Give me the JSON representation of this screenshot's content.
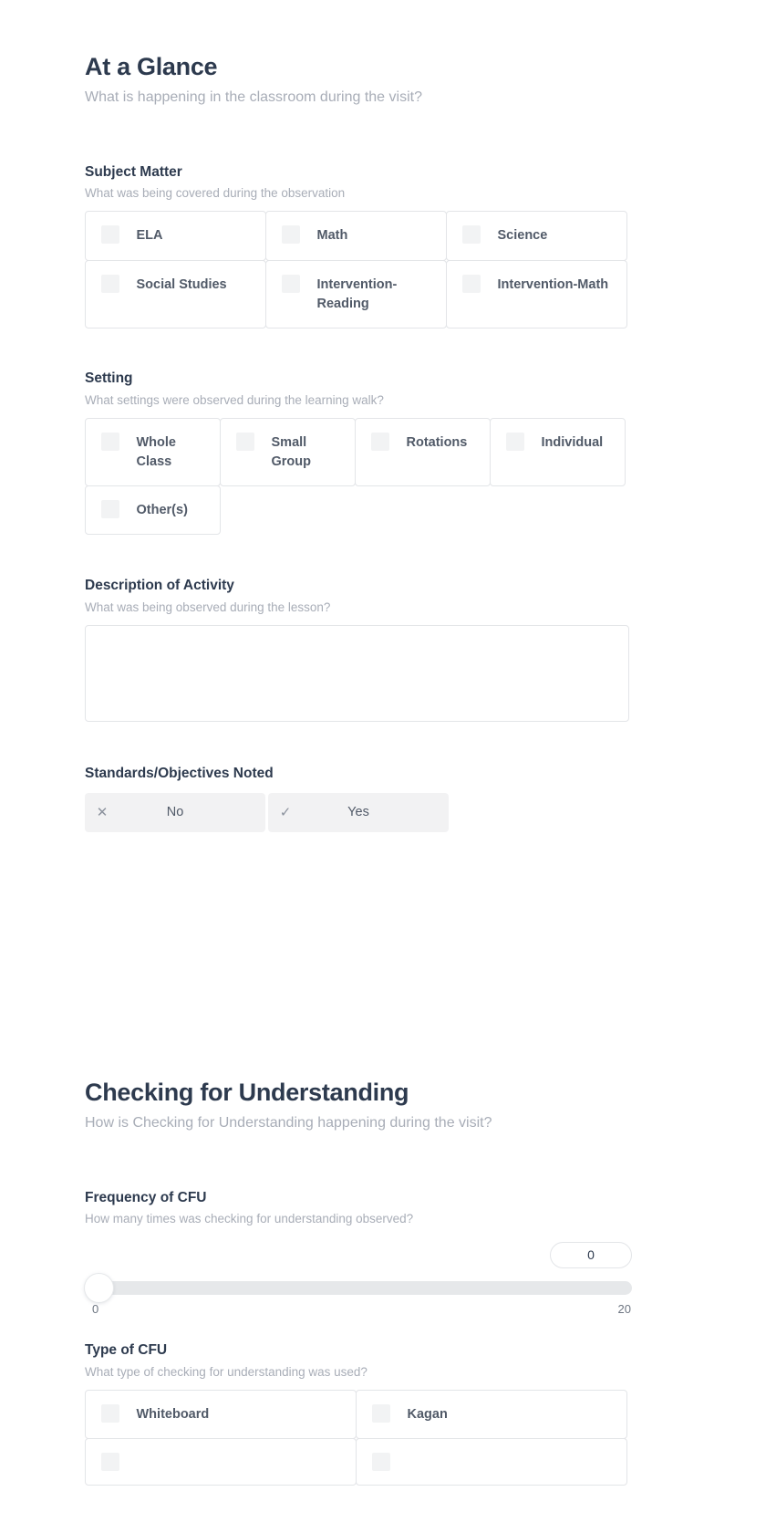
{
  "sections": [
    {
      "id": "at-a-glance",
      "title": "At a Glance",
      "subtitle": "What is happening in the classroom during the visit?"
    },
    {
      "id": "checking-for-understanding",
      "title": "Checking for Understanding",
      "subtitle": "How is Checking for Understanding happening during the visit?"
    }
  ],
  "fields": {
    "subject_matter": {
      "label": "Subject Matter",
      "sublabel": "What was being covered during the observation",
      "options": [
        "ELA",
        "Math",
        "Science",
        "Social Studies",
        "Intervention-Reading",
        "Intervention-Math"
      ]
    },
    "setting": {
      "label": "Setting",
      "sublabel": "What settings were observed during the learning walk?",
      "options": [
        "Whole Class",
        "Small Group",
        "Rotations",
        "Individual",
        "Other(s)"
      ]
    },
    "description_of_activity": {
      "label": "Description of Activity",
      "sublabel": "What was being observed during the lesson?",
      "value": "",
      "placeholder": ""
    },
    "standards_objectives": {
      "label": "Standards/Objectives Noted",
      "options": [
        {
          "icon": "close-icon",
          "glyph": "✕",
          "label": "No"
        },
        {
          "icon": "check-icon",
          "glyph": "✓",
          "label": "Yes"
        }
      ]
    },
    "frequency_of_cfu": {
      "label": "Frequency of CFU",
      "sublabel": "How many times was checking for understanding observed?",
      "value": "0",
      "min": "0",
      "max": "20"
    },
    "type_of_cfu": {
      "label": "Type of CFU",
      "sublabel": "What type of checking for understanding was used?",
      "options": [
        "Whiteboard",
        "Kagan"
      ]
    }
  },
  "colors": {
    "heading": "#2d3a4e",
    "muted": "#a8adb7",
    "option_text": "#515a68",
    "border": "#e3e5e8",
    "checkbox_fill": "#f2f3f4",
    "toggle_fill": "#f2f2f3",
    "track": "#e6e8ea",
    "background": "#ffffff"
  }
}
